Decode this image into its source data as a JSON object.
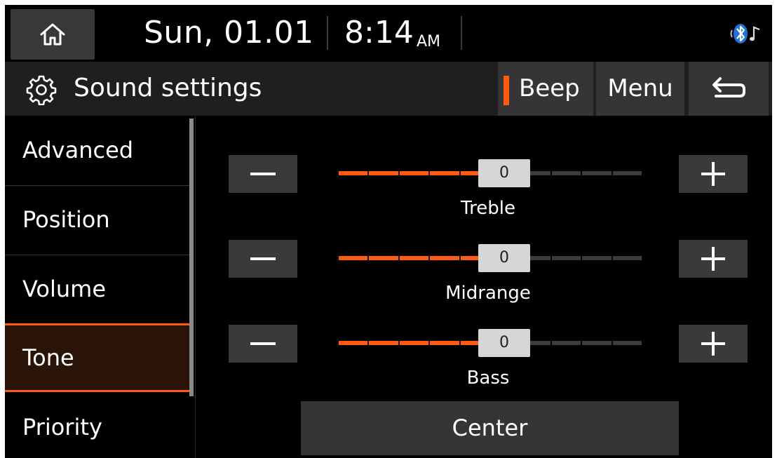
{
  "status": {
    "date": "Sun, 01.01",
    "time": "8:14",
    "ampm": "AM",
    "icons": [
      "home-icon",
      "bluetooth-audio-icon"
    ]
  },
  "header": {
    "title": "Sound settings",
    "beep_label": "Beep",
    "menu_label": "Menu",
    "icons": [
      "gear-icon",
      "back-icon"
    ]
  },
  "sidebar": {
    "items": [
      {
        "label": "Advanced"
      },
      {
        "label": "Position"
      },
      {
        "label": "Volume"
      },
      {
        "label": "Tone"
      },
      {
        "label": "Priority"
      }
    ],
    "active_index": 3
  },
  "tone": {
    "sliders": [
      {
        "label": "Treble",
        "value": "0",
        "level_fraction": 0.5
      },
      {
        "label": "Midrange",
        "value": "0",
        "level_fraction": 0.5
      },
      {
        "label": "Bass",
        "value": "0",
        "level_fraction": 0.5
      }
    ],
    "center_label": "Center"
  },
  "colors": {
    "accent": "#ff5a12",
    "background": "#000000",
    "button": "#3a3a3a",
    "thumb": "#d6d6d6"
  }
}
